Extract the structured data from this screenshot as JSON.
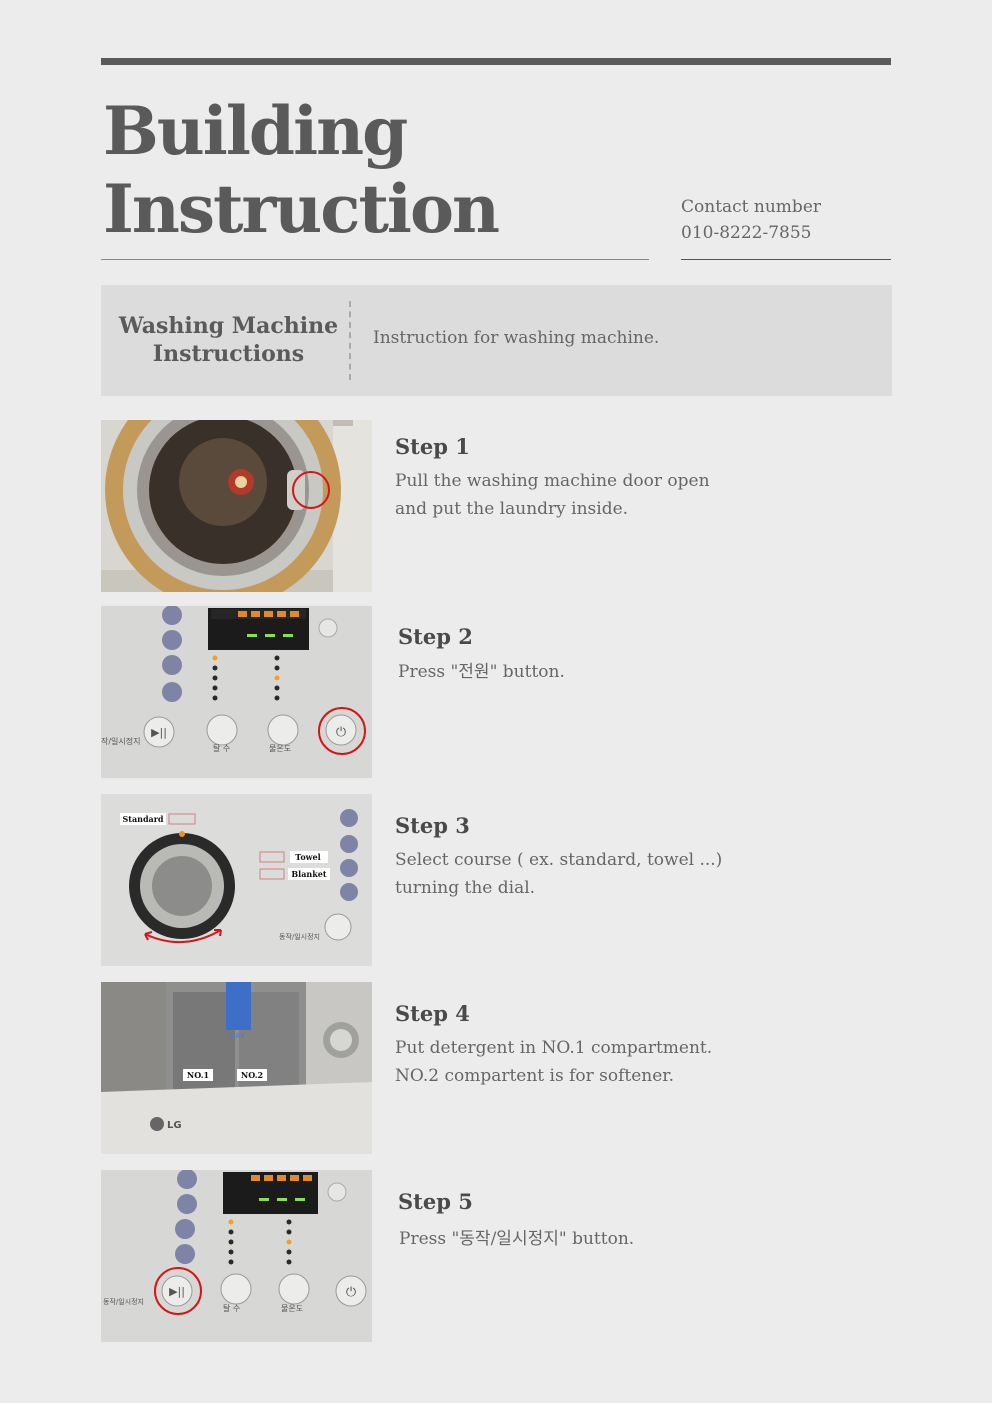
{
  "header": {
    "title_line1": "Building",
    "title_line2": "Instruction",
    "contact_label": "Contact number",
    "contact_number": "010-8222-7855"
  },
  "section": {
    "title_line1": "Washing Machine",
    "title_line2": "Instructions",
    "description": "Instruction for washing machine."
  },
  "steps": [
    {
      "heading": "Step 1",
      "lines": [
        "Pull the washing machine door open",
        "and put the laundry inside."
      ]
    },
    {
      "heading": "Step 2",
      "lines": [
        "Press \"전원\" button."
      ],
      "image_labels": {
        "start_pause": "작/일시정지",
        "spin": "탈 수",
        "temp": "물온도"
      }
    },
    {
      "heading": "Step 3",
      "lines": [
        "Select course ( ex. standard, towel ...)",
        "turning the dial."
      ],
      "image_labels": {
        "standard": "Standard",
        "towel": "Towel",
        "blanket": "Blanket",
        "start_pause": "동작/일시정지"
      }
    },
    {
      "heading": "Step 4",
      "lines": [
        "Put detergent in NO.1 compartment.",
        "NO.2 compartent is for softener."
      ],
      "image_labels": {
        "no1": "NO.1",
        "no2": "NO.2",
        "max": "MAX",
        "brand": "LG"
      }
    },
    {
      "heading": "Step 5",
      "lines": [
        "Press \"동작/일시정지\" button."
      ],
      "image_labels": {
        "start_pause": "동작/일시정지",
        "spin": "탈 수",
        "temp": "물온도"
      }
    }
  ]
}
